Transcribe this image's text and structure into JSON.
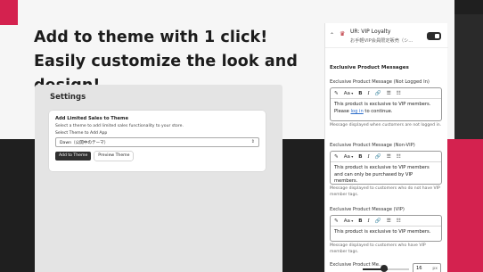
{
  "headline": {
    "line1": "Add to theme with 1 click!",
    "line2": "Easily customize the look and design!"
  },
  "settings": {
    "title": "Settings",
    "card": {
      "title": "Add Limited Sales to Theme",
      "description": "Select a theme to add limited sales functionality to your store.",
      "select_label": "Select Theme to Add App",
      "select_value": "Dawn（公開中のテーマ）",
      "add_button": "Add to Theme",
      "preview_button": "Preview Theme"
    }
  },
  "editor": {
    "app_name": "UR: VIP Loyalty",
    "app_subtitle": "お手軽VIP会員限定販売（シ…",
    "toggle_on": true,
    "section_heading": "Exclusive Product Messages",
    "toolbar": {
      "format": "Aa",
      "bold": "B",
      "italic": "I",
      "link": "⌁"
    },
    "fields": [
      {
        "label": "Exclusive Product Message (Not Logged In)",
        "text_before": "This product is exclusive to VIP members. Please ",
        "link_text": "log in",
        "text_after": " to continue.",
        "help": "Message displayed when customers are not logged in."
      },
      {
        "label": "Exclusive Product Message (Non-VIP)",
        "text_before": "This product is exclusive to VIP members and can only be purchased by VIP members.",
        "link_text": "",
        "text_after": "",
        "help": "Message displayed to customers who do not have VIP member tags."
      },
      {
        "label": "Exclusive Product Message (VIP)",
        "text_before": "This product is exclusive to VIP members.",
        "link_text": "",
        "text_after": "",
        "help": "Message displayed to customers who have VIP member tags."
      }
    ],
    "bottom_label": "Exclusive Product Me...",
    "size_value": "16",
    "size_unit": "px",
    "slider_fraction": 0.43
  },
  "colors": {
    "accent_red": "#d4224f",
    "dark": "#1f1f1f",
    "link": "#2c6ecb"
  }
}
